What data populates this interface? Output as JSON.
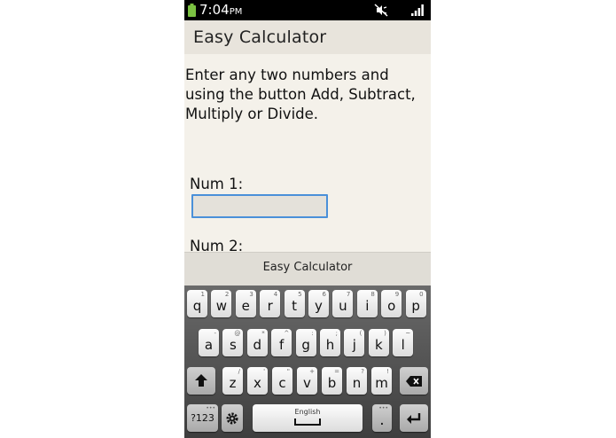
{
  "status_bar": {
    "time": "7:04",
    "ampm": "PM",
    "icons": [
      "battery-icon",
      "mute-icon",
      "signal-icon"
    ]
  },
  "app": {
    "title": "Easy Calculator"
  },
  "content": {
    "instructions": "Enter any two numbers and using the button Add, Subtract, Multiply or Divide.",
    "num1_label": "Num 1:",
    "num1_value": "",
    "num2_label": "Num 2:"
  },
  "suggestion_bar": {
    "text": "Easy Calculator"
  },
  "keyboard": {
    "row1": [
      {
        "main": "q",
        "alt": "1"
      },
      {
        "main": "w",
        "alt": "2"
      },
      {
        "main": "e",
        "alt": "3"
      },
      {
        "main": "r",
        "alt": "4"
      },
      {
        "main": "t",
        "alt": "5"
      },
      {
        "main": "y",
        "alt": "6"
      },
      {
        "main": "u",
        "alt": "7"
      },
      {
        "main": "i",
        "alt": "8"
      },
      {
        "main": "o",
        "alt": "9"
      },
      {
        "main": "p",
        "alt": "0"
      }
    ],
    "row2": [
      {
        "main": "a",
        "alt": "-"
      },
      {
        "main": "s",
        "alt": "@"
      },
      {
        "main": "d",
        "alt": "*"
      },
      {
        "main": "f",
        "alt": "^"
      },
      {
        "main": "g",
        "alt": ":"
      },
      {
        "main": "h",
        "alt": ";"
      },
      {
        "main": "j",
        "alt": "("
      },
      {
        "main": "k",
        "alt": ")"
      },
      {
        "main": "l",
        "alt": "~"
      }
    ],
    "row3": [
      {
        "main": "z",
        "alt": "/"
      },
      {
        "main": "x",
        "alt": "'"
      },
      {
        "main": "c",
        "alt": "\""
      },
      {
        "main": "v",
        "alt": "+"
      },
      {
        "main": "b",
        "alt": "="
      },
      {
        "main": "n",
        "alt": "?"
      },
      {
        "main": "m",
        "alt": "!"
      }
    ],
    "symbols_label": "?123",
    "space_label": "English",
    "period_label": "."
  },
  "colors": {
    "status_bar_bg": "#000000",
    "app_bg": "#f4f1ea",
    "input_border": "#4a90d9"
  }
}
